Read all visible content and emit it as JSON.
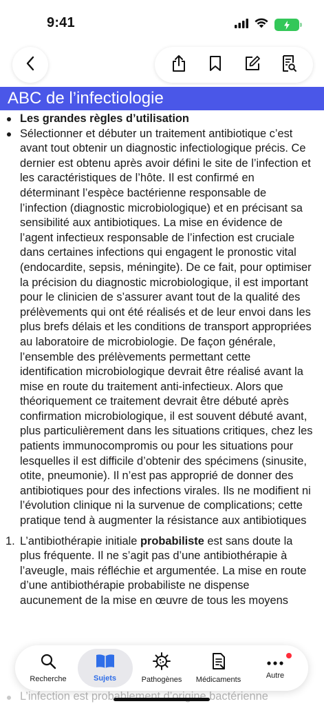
{
  "status_bar": {
    "time": "9:41"
  },
  "nav": {
    "back_icon": "chevron-left-icon",
    "actions": [
      "share-icon",
      "bookmark-icon",
      "note-edit-icon",
      "search-document-icon"
    ]
  },
  "title": "ABC de l’infectiologie",
  "content": {
    "heading_bullet": "Les grandes règles d’utilisation",
    "paragraph": "Sélectionner et débuter un traitement antibiotique c’est avant tout obtenir un diagnostic infectiologique précis. Ce dernier est obtenu après avoir défini le site de l’infection et les caractéristiques de l’hôte. Il est confirmé en déterminant l’espèce bactérienne responsable de l’infection (diagnostic microbiologique) et en précisant sa sensibilité aux antibiotiques. La mise en évidence de l’agent infectieux responsable de l’infection est cruciale dans certaines infections qui engagent le pronostic vital (endocardite, sepsis, méningite). De ce fait, pour optimiser la précision du diagnostic microbiologique, il est important pour le clinicien de s’assurer avant tout de la qualité des prélèvements qui ont été réalisés et de leur envoi dans les plus brefs délais et les conditions de transport appropriées au laboratoire de microbiologie. De façon générale, l’ensemble des prélèvements permettant cette identification microbiologique devrait être réalisé avant la mise en route du traitement anti-infectieux. Alors que théoriquement ce traitement devrait être débuté après confirmation microbiologique, il est souvent débuté avant, plus particulièrement dans les situations critiques, chez les patients immunocompromis ou pour les situations pour lesquelles il est difficile d’obtenir des spécimens (sinusite, otite, pneumonie). Il n’est pas approprié de donner des antibiotiques pour des infections virales. Ils ne modifient ni l’évolution clinique ni la survenue de complications; cette pratique tend à augmenter la résistance aux antibiotiques",
    "numbered_item": {
      "number": "1.",
      "prefix": "L’antibiothérapie initiale ",
      "bold": "probabiliste",
      "suffix": " est sans doute la plus fréquente. Il ne s’agit pas d’une antibiothérapie à l’aveugle, mais réfléchie et argumentée. La mise en route d’une antibiothérapie probabiliste ne dispense aucunement de la mise en œuvre de tous les moyens"
    },
    "faded_bullet": "L’infection est probablement d’origine bactérienne"
  },
  "tabbar": {
    "tabs": [
      {
        "label": "Recherche",
        "icon": "search-icon"
      },
      {
        "label": "Sujets",
        "icon": "book-icon"
      },
      {
        "label": "Pathogènes",
        "icon": "virus-icon"
      },
      {
        "label": "Médicaments",
        "icon": "prescription-icon"
      },
      {
        "label": "Autre",
        "icon": "more-icon"
      }
    ],
    "accent": "#2f6ee8",
    "badge_color": "#ff2d3a"
  },
  "colors": {
    "title_bar": "#4a57e8"
  }
}
